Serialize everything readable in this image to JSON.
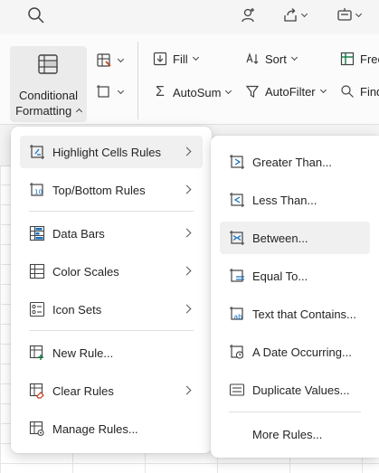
{
  "ribbon": {
    "conditional_formatting_line1": "Conditional",
    "conditional_formatting_line2": "Formatting",
    "fill_label": "Fill",
    "autosum_label": "AutoSum",
    "sort_label": "Sort",
    "autofilter_label": "AutoFilter",
    "freeze_label": "Free",
    "find_label": "Find"
  },
  "main_menu": {
    "items": [
      {
        "label": "Highlight Cells Rules",
        "icon": "highlight-cells-icon",
        "has_submenu": true,
        "highlighted": true
      },
      {
        "label": "Top/Bottom Rules",
        "icon": "top-bottom-icon",
        "has_submenu": true
      },
      {
        "label": "Data Bars",
        "icon": "data-bars-icon",
        "has_submenu": true
      },
      {
        "label": "Color Scales",
        "icon": "color-scales-icon",
        "has_submenu": true
      },
      {
        "label": "Icon Sets",
        "icon": "icon-sets-icon",
        "has_submenu": true
      },
      {
        "label": "New Rule...",
        "icon": "new-rule-icon",
        "has_submenu": false
      },
      {
        "label": "Clear Rules",
        "icon": "clear-rules-icon",
        "has_submenu": true
      },
      {
        "label": "Manage Rules...",
        "icon": "manage-rules-icon",
        "has_submenu": false
      }
    ]
  },
  "sub_menu": {
    "items": [
      {
        "label": "Greater Than...",
        "icon": "greater-than-icon"
      },
      {
        "label": "Less Than...",
        "icon": "less-than-icon"
      },
      {
        "label": "Between...",
        "icon": "between-icon",
        "highlighted": true
      },
      {
        "label": "Equal To...",
        "icon": "equal-to-icon"
      },
      {
        "label": "Text that Contains...",
        "icon": "text-contains-icon"
      },
      {
        "label": "A Date Occurring...",
        "icon": "date-occurring-icon"
      },
      {
        "label": "Duplicate Values...",
        "icon": "duplicate-values-icon"
      },
      {
        "label": "More Rules...",
        "icon": ""
      }
    ]
  },
  "colors": {
    "accent": "#0f6cbd",
    "menu_highlight": "#f0f0f0",
    "icon": "#424242"
  }
}
